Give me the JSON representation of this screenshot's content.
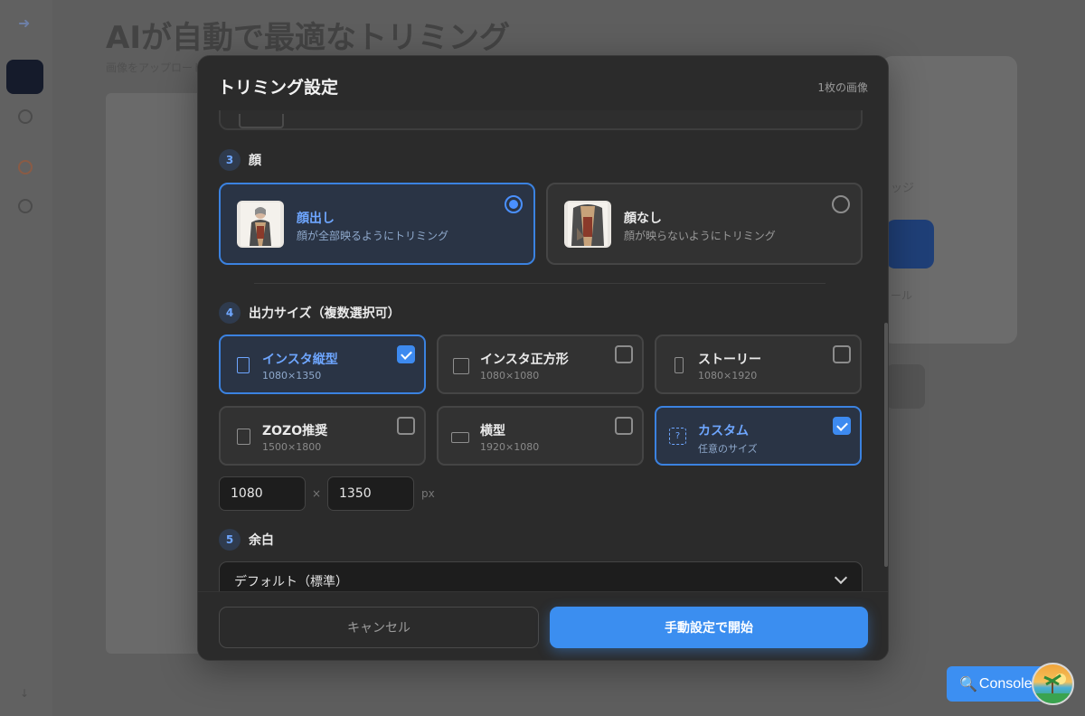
{
  "background": {
    "title": "AIが自動で最適なトリミング",
    "subtitle": "画像をアップロードして",
    "right_text": "ッジ",
    "right_text2": "ール"
  },
  "modal": {
    "title": "トリミング設定",
    "image_count": "1枚の画像",
    "face_section": {
      "number": "3",
      "label": "顔",
      "options": [
        {
          "title": "顔出し",
          "description": "顔が全部映るようにトリミング",
          "selected": true
        },
        {
          "title": "顔なし",
          "description": "顔が映らないようにトリミング",
          "selected": false
        }
      ]
    },
    "size_section": {
      "number": "4",
      "label": "出力サイズ（複数選択可）",
      "options": [
        {
          "title": "インスタ縦型",
          "size": "1080×1350",
          "checked": true
        },
        {
          "title": "インスタ正方形",
          "size": "1080×1080",
          "checked": false
        },
        {
          "title": "ストーリー",
          "size": "1080×1920",
          "checked": false
        },
        {
          "title": "ZOZO推奨",
          "size": "1500×1800",
          "checked": false
        },
        {
          "title": "横型",
          "size": "1920×1080",
          "checked": false
        },
        {
          "title": "カスタム",
          "size": "任意のサイズ",
          "checked": true
        }
      ],
      "custom_width": "1080",
      "custom_height": "1350",
      "times": "×",
      "unit": "px"
    },
    "margin_section": {
      "number": "5",
      "label": "余白",
      "selected": "デフォルト（標準）"
    },
    "buttons": {
      "cancel": "キャンセル",
      "start": "手動設定で開始"
    }
  },
  "console": {
    "label": "Console"
  },
  "colors": {
    "accent": "#3b8ef0",
    "selected_border": "#3b82e0",
    "modal_bg": "#2b2b2b"
  }
}
